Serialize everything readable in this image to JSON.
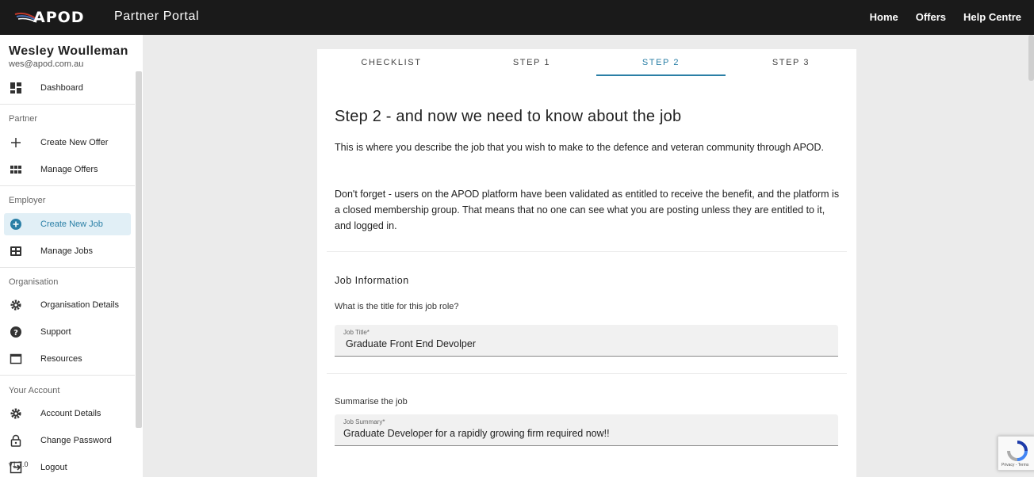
{
  "header": {
    "logo_text": "APOD",
    "portal_title": "Partner Portal",
    "nav": [
      "Home",
      "Offers",
      "Help Centre"
    ]
  },
  "sidebar": {
    "user_name": "Wesley Woulleman",
    "user_email": "wes@apod.com.au",
    "dashboard": "Dashboard",
    "partner_heading": "Partner",
    "create_offer": "Create New Offer",
    "manage_offers": "Manage Offers",
    "employer_heading": "Employer",
    "create_job": "Create New Job",
    "manage_jobs": "Manage Jobs",
    "organisation_heading": "Organisation",
    "organisation_details": "Organisation Details",
    "support": "Support",
    "resources": "Resources",
    "account_heading": "Your Account",
    "account_details": "Account Details",
    "change_password": "Change Password",
    "logout": "Logout",
    "version": "v1.7.0",
    "active_item": "Create New Job"
  },
  "tabs": [
    "CHECKLIST",
    "STEP 1",
    "STEP 2",
    "STEP 3"
  ],
  "active_tab": "STEP 2",
  "main": {
    "heading": "Step 2 - and now we need to know about the job",
    "para1": "This is where you describe the job that you wish to make to the defence and veteran community through APOD.",
    "para2": "Don't forget - users on the APOD platform have been validated as entitled to receive the benefit, and the platform is a closed membership group. That means that no one can see what you are posting unless they are entitled to it, and logged in.",
    "job_info_title": "Job Information",
    "title_question": "What is the title for this job role?",
    "job_title_label": "Job Title*",
    "job_title_value": "Graduate Front End Devolper",
    "summary_question": "Summarise the job",
    "job_summary_label": "Job Summary*",
    "job_summary_value": "Graduate Developer for a rapidly growing firm required now!!"
  },
  "recaptcha": {
    "terms": "Privacy - Terms"
  },
  "colors": {
    "accent": "#2a7fa6",
    "topbar": "#1a1a1a",
    "background": "#ebebeb"
  }
}
